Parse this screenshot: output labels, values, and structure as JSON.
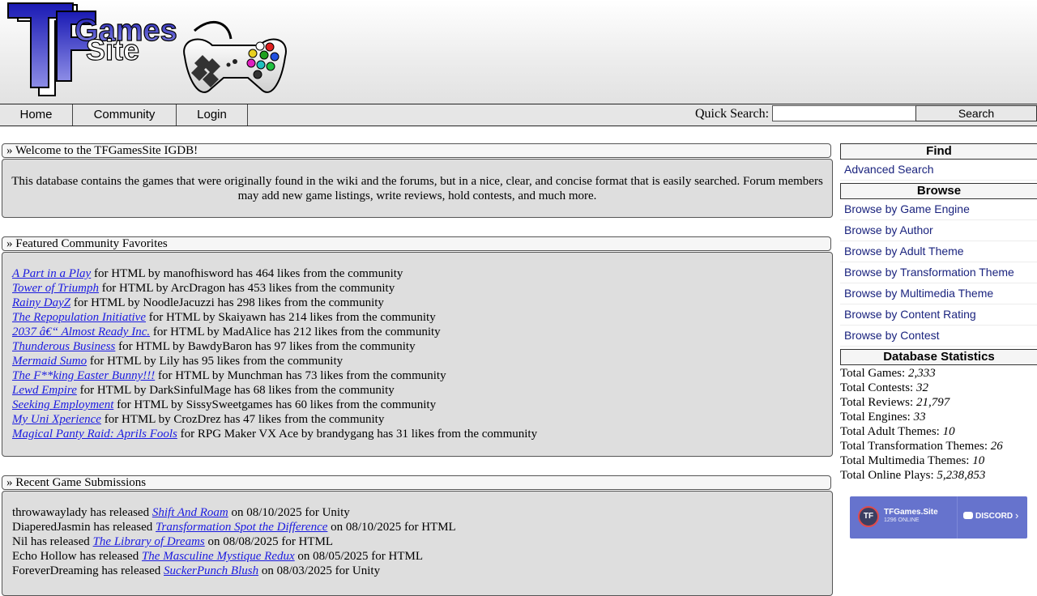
{
  "nav": {
    "items": [
      {
        "label": "Home"
      },
      {
        "label": "Community"
      },
      {
        "label": "Login"
      }
    ],
    "quick_search_label": "Quick Search:",
    "quick_search_value": "",
    "search_button": "Search"
  },
  "welcome": {
    "title": "» Welcome to the TFGamesSite IGDB!",
    "text": "This database contains the games that were originally found in the wiki and the forums, but in a nice, clear, and concise format that is easily searched. Forum members may add new game listings, write reviews, hold contests, and much more."
  },
  "featured": {
    "title": "» Featured Community Favorites",
    "items": [
      {
        "game": "A Part in a Play",
        "desc": " for HTML by manofhisword has 464 likes from the community"
      },
      {
        "game": "Tower of Triumph",
        "desc": " for HTML by ArcDragon has 453 likes from the community"
      },
      {
        "game": "Rainy DayZ",
        "desc": " for HTML by NoodleJacuzzi has 298 likes from the community"
      },
      {
        "game": "The Repopulation Initiative",
        "desc": " for HTML by Skaiyawn has 214 likes from the community"
      },
      {
        "game": "2037 â€“ Almost Ready Inc.",
        "desc": " for HTML by MadAlice has 212 likes from the community"
      },
      {
        "game": "Thunderous Business",
        "desc": " for HTML by BawdyBaron has 97 likes from the community"
      },
      {
        "game": "Mermaid Sumo",
        "desc": " for HTML by Lily has 95 likes from the community"
      },
      {
        "game": "The F**king Easter Bunny!!!",
        "desc": " for HTML by Munchman has 73 likes from the community"
      },
      {
        "game": "Lewd Empire",
        "desc": " for HTML by DarkSinfulMage has 68 likes from the community"
      },
      {
        "game": "Seeking Employment",
        "desc": " for HTML by SissySweetgames has 60 likes from the community"
      },
      {
        "game": "My Uni Xperience",
        "desc": " for HTML by CrozDrez has 47 likes from the community"
      },
      {
        "game": "Magical Panty Raid: Aprils Fools",
        "desc": " for RPG Maker VX Ace by brandygang has 31 likes from the community"
      }
    ]
  },
  "recent": {
    "title": "» Recent Game Submissions",
    "items": [
      {
        "author": "throwawaylady",
        "mid": " has released ",
        "game": "Shift And Roam",
        "rest": " on 08/10/2025 for Unity"
      },
      {
        "author": "DiaperedJasmin",
        "mid": " has released ",
        "game": "Transformation Spot the Difference",
        "rest": " on 08/10/2025 for HTML"
      },
      {
        "author": "Nil",
        "mid": " has released ",
        "game": "The Library of Dreams",
        "rest": " on 08/08/2025 for HTML"
      },
      {
        "author": "Echo Hollow",
        "mid": " has released ",
        "game": "The Masculine Mystique Redux",
        "rest": " on 08/05/2025 for HTML"
      },
      {
        "author": "ForeverDreaming",
        "mid": " has released ",
        "game": "SuckerPunch Blush",
        "rest": " on 08/03/2025 for Unity"
      }
    ]
  },
  "sidebar": {
    "find_title": "Find",
    "advanced_search": "Advanced Search",
    "browse_title": "Browse",
    "browse_links": [
      "Browse by Game Engine",
      "Browse by Author",
      "Browse by Adult Theme",
      "Browse by Transformation Theme",
      "Browse by Multimedia Theme",
      "Browse by Content Rating",
      "Browse by Contest"
    ],
    "stats_title": "Database Statistics",
    "stats": [
      {
        "label": "Total Games: ",
        "value": "2,333"
      },
      {
        "label": "Total Contests: ",
        "value": "32"
      },
      {
        "label": "Total Reviews: ",
        "value": "21,797"
      },
      {
        "label": "Total Engines: ",
        "value": "33"
      },
      {
        "label": "Total Adult Themes: ",
        "value": "10"
      },
      {
        "label": "Total Transformation Themes: ",
        "value": "26"
      },
      {
        "label": "Total Multimedia Themes: ",
        "value": "10"
      },
      {
        "label": "Total Online Plays: ",
        "value": "5,238,853"
      }
    ]
  },
  "discord": {
    "server": "TFGames.Site",
    "online": "1296 ONLINE",
    "brand": "DISCORD",
    "icon_text": "TF"
  },
  "logo": {
    "text_games": "Games",
    "text_site": "Site",
    "text_tf": "TF"
  }
}
